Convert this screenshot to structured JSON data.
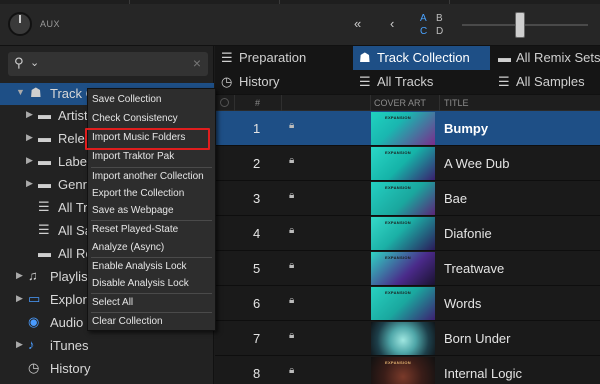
{
  "topbar": {
    "aux_label": "AUX",
    "nav_first": "«",
    "nav_prev": "‹",
    "decks": [
      "A",
      "B",
      "C",
      "D"
    ]
  },
  "browser": {
    "search_placeholder": "",
    "tree": [
      {
        "label": "Track Collection",
        "icon": "collection-icon",
        "expanded": true,
        "selected": true
      },
      {
        "label": "Artists",
        "icon": "folder-icon"
      },
      {
        "label": "Releases",
        "icon": "folder-icon"
      },
      {
        "label": "Labels",
        "icon": "folder-icon"
      },
      {
        "label": "Genres",
        "icon": "folder-icon"
      },
      {
        "label": "All Tracks",
        "icon": "list-icon"
      },
      {
        "label": "All Samples",
        "icon": "list-icon"
      },
      {
        "label": "All Remix Sets",
        "icon": "folder-icon"
      },
      {
        "label": "Playlists",
        "icon": "playlist-icon"
      },
      {
        "label": "Explorer",
        "icon": "computer-icon"
      },
      {
        "label": "Audio Recordings",
        "icon": "audio-icon"
      },
      {
        "label": "iTunes",
        "icon": "music-note-icon"
      },
      {
        "label": "History",
        "icon": "clock-icon"
      }
    ]
  },
  "favorites": {
    "row1": [
      {
        "label": "Preparation",
        "icon": "list-icon"
      },
      {
        "label": "Track Collection",
        "icon": "collection-icon",
        "active": true
      },
      {
        "label": "All Remix Sets",
        "icon": "folder-icon"
      }
    ],
    "row2": [
      {
        "label": "History",
        "icon": "clock-icon"
      },
      {
        "label": "All Tracks",
        "icon": "list-icon"
      },
      {
        "label": "All Samples",
        "icon": "list-icon"
      }
    ]
  },
  "table": {
    "headers": {
      "num": "#",
      "cover": "COVER ART",
      "title": "TITLE"
    },
    "rows": [
      {
        "num": "1",
        "title": "Bumpy",
        "selected": true
      },
      {
        "num": "2",
        "title": "A Wee Dub"
      },
      {
        "num": "3",
        "title": "Bae"
      },
      {
        "num": "4",
        "title": "Diafonie"
      },
      {
        "num": "5",
        "title": "Treatwave"
      },
      {
        "num": "6",
        "title": "Words"
      },
      {
        "num": "7",
        "title": "Born Under"
      },
      {
        "num": "8",
        "title": "Internal Logic"
      }
    ],
    "cover_text": "EXPANSION"
  },
  "context_menu": {
    "groups": [
      [
        "Save Collection",
        "Check Consistency",
        "Import Music Folders",
        "Import Traktor Pak"
      ],
      [
        "Import another Collection",
        "Export the Collection",
        "Save as Webpage"
      ],
      [
        "Reset Played-State",
        "Analyze (Async)"
      ],
      [
        "Enable Analysis Lock",
        "Disable Analysis Lock"
      ],
      [
        "Select All"
      ],
      [
        "Clear Collection"
      ]
    ],
    "highlighted": "Import Music Folders"
  },
  "colors": {
    "accent": "#1e4f86",
    "highlight_box": "#e01e1e",
    "deck_active": "#4aa3ff"
  }
}
